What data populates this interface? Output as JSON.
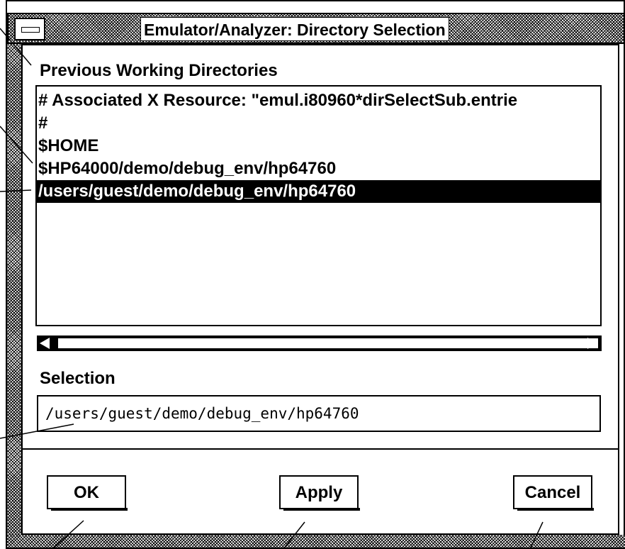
{
  "window": {
    "title": "Emulator/Analyzer: Directory Selection"
  },
  "previous": {
    "label": "Previous Working Directories",
    "items": [
      {
        "text": "# Associated X Resource: \"emul.i80960*dirSelectSub.entrie",
        "selected": false
      },
      {
        "text": "#",
        "selected": false
      },
      {
        "text": "$HOME",
        "selected": false
      },
      {
        "text": "$HP64000/demo/debug_env/hp64760",
        "selected": false
      },
      {
        "text": "/users/guest/demo/debug_env/hp64760",
        "selected": true
      }
    ]
  },
  "selection": {
    "label": "Selection",
    "value": "/users/guest/demo/debug_env/hp64760"
  },
  "buttons": {
    "ok": "OK",
    "apply": "Apply",
    "cancel": "Cancel"
  }
}
